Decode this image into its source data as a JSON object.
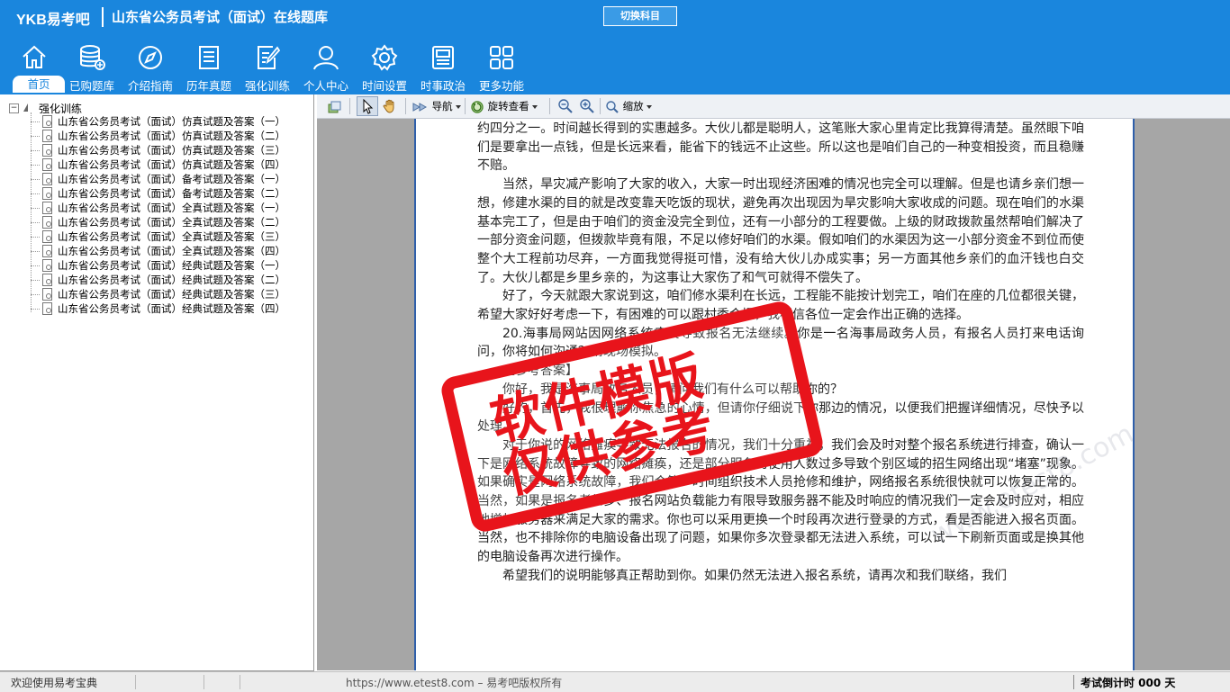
{
  "header": {
    "logo": "YKB易考吧",
    "title": "山东省公务员考试（面试）在线题库",
    "switch_button": "切换科目",
    "nav": [
      {
        "label": "首页",
        "icon": "home-icon",
        "active": true
      },
      {
        "label": "已购题库",
        "icon": "database-icon"
      },
      {
        "label": "介绍指南",
        "icon": "compass-icon"
      },
      {
        "label": "历年真题",
        "icon": "list-doc-icon"
      },
      {
        "label": "强化训练",
        "icon": "edit-doc-icon"
      },
      {
        "label": "个人中心",
        "icon": "user-icon"
      },
      {
        "label": "时间设置",
        "icon": "gear-icon"
      },
      {
        "label": "时事政治",
        "icon": "newspaper-icon"
      },
      {
        "label": "更多功能",
        "icon": "grid-icon"
      }
    ]
  },
  "sidebar": {
    "root": "强化训练",
    "items": [
      "山东省公务员考试（面试）仿真试题及答案（一）",
      "山东省公务员考试（面试）仿真试题及答案（二）",
      "山东省公务员考试（面试）仿真试题及答案（三）",
      "山东省公务员考试（面试）仿真试题及答案（四）",
      "山东省公务员考试（面试）备考试题及答案（一）",
      "山东省公务员考试（面试）备考试题及答案（二）",
      "山东省公务员考试（面试）全真试题及答案（一）",
      "山东省公务员考试（面试）全真试题及答案（二）",
      "山东省公务员考试（面试）全真试题及答案（三）",
      "山东省公务员考试（面试）全真试题及答案（四）",
      "山东省公务员考试（面试）经典试题及答案（一）",
      "山东省公务员考试（面试）经典试题及答案（二）",
      "山东省公务员考试（面试）经典试题及答案（三）",
      "山东省公务员考试（面试）经典试题及答案（四）"
    ]
  },
  "toolbar": {
    "nav": "导航",
    "rotate": "旋转查看",
    "zoom": "缩放"
  },
  "document": {
    "paragraphs": [
      {
        "text": "约四分之一。时间越长得到的实惠越多。大伙儿都是聪明人，这笔账大家心里肯定比我算得清楚。虽然眼下咱们是要拿出一点钱，但是长远来看，能省下的钱远不止这些。所以这也是咱们自己的一种变相投资，而且稳赚不赔。",
        "indent": false
      },
      {
        "text": "当然，旱灾减产影响了大家的收入，大家一时出现经济困难的情况也完全可以理解。但是也请乡亲们想一想，修建水渠的目的就是改变靠天吃饭的现状，避免再次出现因为旱灾影响大家收成的问题。现在咱们的水渠基本完工了，但是由于咱们的资金没完全到位，还有一小部分的工程要做。上级的财政拨款虽然帮咱们解决了一部分资金问题，但拨款毕竟有限，不足以修好咱们的水渠。假如咱们的水渠因为这一小部分资金不到位而使整个大工程前功尽弃，一方面我觉得挺可惜，没有给大伙儿办成实事；另一方面其他乡亲们的血汗钱也白交了。大伙儿都是乡里乡亲的，为这事让大家伤了和气可就得不偿失了。",
        "indent": true
      },
      {
        "text": "好了，今天就跟大家说到这，咱们修水渠利在长远，工程能不能按计划完工，咱们在座的几位都很关键，希望大家好好考虑一下，有困难的可以跟村委会提，我相信各位一定会作出正确的选择。",
        "indent": true
      },
      {
        "text": "20.海事局网站因网络系统瘫痪导致报名无法继续。你是一名海事局政务人员，有报名人员打来电话询问，你将如何沟通？请现场模拟。",
        "indent": true
      },
      {
        "text": "【参考答案】",
        "indent": true
      },
      {
        "text": "你好，我是海事局政务人员，请问我们有什么可以帮助你的？",
        "indent": true
      },
      {
        "text": "好的，首先，我很理解你焦急的心情，但请你仔细说下你那边的情况，以便我们把握详细情况，尽快予以处理。",
        "indent": true
      },
      {
        "text": "对于你说的网络瘫痪导致无法报名的情况，我们十分重视，我们会及时对整个报名系统进行排查，确认一下是网络系统故障导致的网络瘫痪，还是部分服务的使用人数过多导致个别区域的招生网络出现“堵塞”现象。如果确实是网络系统故障，我们会第一时间组织技术人员抢修和维护，网络报名系统很快就可以恢复正常的。当然，如果是报名者甚多、报名网站负载能力有限导致服务器不能及时响应的情况我们一定会及时应对，相应地增加服务器来满足大家的需求。你也可以采用更换一个时段再次进行登录的方式，看是否能进入报名页面。当然，也不排除你的电脑设备出现了问题，如果你多次登录都无法进入系统，可以试一下刷新页面或是换其他的电脑设备再次进行操作。",
        "indent": true
      },
      {
        "text": "希望我们的说明能够真正帮助到你。如果仍然无法进入报名系统，请再次和我们联络，我们",
        "indent": true
      }
    ],
    "watermark_line1": "软件模版",
    "watermark_line2": "仅供参考",
    "faint_watermark": "www.etest8.com"
  },
  "status": {
    "welcome": "欢迎使用易考宝典",
    "copyright": "https://www.etest8.com – 易考吧版权所有",
    "countdown": "考试倒计时 000 天"
  },
  "colors": {
    "header_bg": "#1a86dd",
    "watermark_red": "#e8141b",
    "viewer_bg": "#a6a6a6"
  }
}
